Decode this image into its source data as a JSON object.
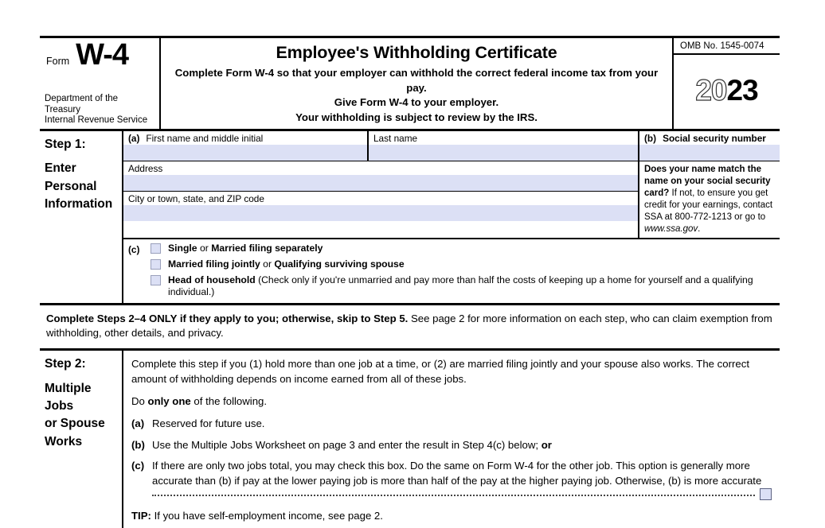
{
  "header": {
    "form_word": "Form",
    "form_number": "W-4",
    "department_line1": "Department of the Treasury",
    "department_line2": "Internal Revenue Service",
    "title": "Employee's Withholding Certificate",
    "subtitle_line1": "Complete Form W-4 so that your employer can withhold the correct federal income tax from your pay.",
    "subtitle_line2": "Give Form W-4 to your employer.",
    "subtitle_line3": "Your withholding is subject to review by the IRS.",
    "omb": "OMB No. 1545-0074",
    "year_prefix": "20",
    "year_suffix": "23"
  },
  "step1": {
    "label_number": "Step 1:",
    "label_text": "Enter Personal Information",
    "label_line1": "Enter",
    "label_line2": "Personal",
    "label_line3": "Information",
    "fields": {
      "first_name_letter": "(a)",
      "first_name_label": "First name and middle initial",
      "first_name_value": "",
      "last_name_label": "Last name",
      "last_name_value": "",
      "address_label": "Address",
      "address_value": "",
      "city_label": "City or town, state, and ZIP code",
      "city_value": "",
      "ssn_letter": "(b)",
      "ssn_label": "Social security number",
      "ssn_value": "",
      "ssn_note_bold": "Does your name match the name on your social security card?",
      "ssn_note_rest": " If not, to ensure you get credit for your earnings, contact SSA at 800-772-1213 or go to ",
      "ssn_note_link": "www.ssa.gov",
      "ssn_note_end": "."
    },
    "filing_status": {
      "letter": "(c)",
      "options": [
        {
          "bold": "Single",
          "rest": " or ",
          "bold2": "Married filing separately",
          "rest2": ""
        },
        {
          "bold": "Married filing jointly",
          "rest": " or ",
          "bold2": "Qualifying surviving spouse",
          "rest2": ""
        },
        {
          "bold": "Head of household",
          "rest": " (Check only if you're unmarried and pay more than half the costs of keeping up a home for yourself and a qualifying individual.)",
          "bold2": "",
          "rest2": ""
        }
      ]
    }
  },
  "notice": {
    "bold": "Complete Steps 2–4 ONLY if they apply to you; otherwise, skip to Step 5.",
    "rest": " See page 2 for more information on each step, who can claim exemption from withholding, other details, and privacy."
  },
  "step2": {
    "label_number": "Step 2:",
    "label_line1": "Multiple Jobs",
    "label_line2": "or Spouse",
    "label_line3": "Works",
    "intro": "Complete this step if you (1) hold more than one job at a time, or (2) are married filing jointly and your spouse also works. The correct amount of withholding depends on income earned from all of these jobs.",
    "do_one_pre": "Do ",
    "do_one_bold": "only one",
    "do_one_post": " of the following.",
    "items": [
      {
        "letter": "(a)",
        "text": "Reserved for future use.",
        "trailing_bold": ""
      },
      {
        "letter": "(b)",
        "text": "Use the Multiple Jobs Worksheet on page 3 and enter the result in Step 4(c) below; ",
        "trailing_bold": "or"
      },
      {
        "letter": "(c)",
        "text": "If there are only two jobs total, you may check this box. Do the same on Form W-4 for the other job. This option is generally more accurate than (b) if pay at the lower paying job is more than half of the pay at the higher paying job. Otherwise, (b) is more accurate",
        "trailing_bold": ""
      }
    ],
    "checkbox_c_value": "",
    "tip_bold": "TIP:",
    "tip_rest": " If you have self-employment income, see page 2."
  },
  "colors": {
    "field_fill": "#dce0f5",
    "border": "#000000"
  }
}
